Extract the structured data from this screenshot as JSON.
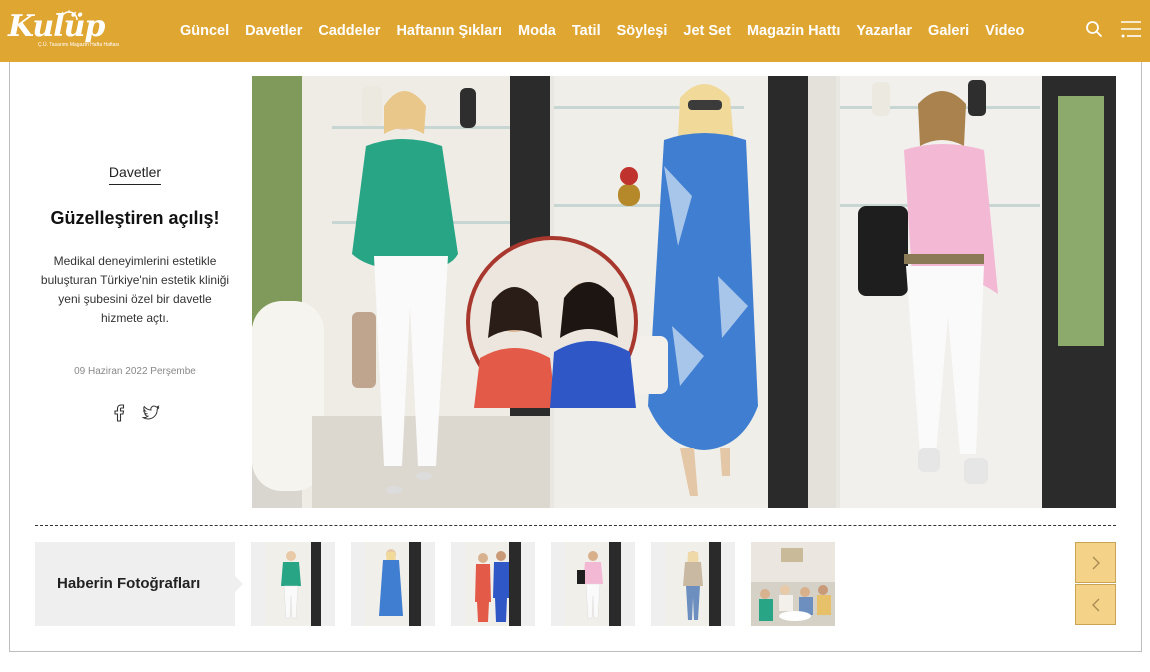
{
  "site": {
    "logo_text": "Kulüp",
    "logo_tagline": "Ç.Ü. Tasarımı Magazin Hafta Haftası"
  },
  "nav": {
    "items": [
      {
        "label": "Güncel"
      },
      {
        "label": "Davetler"
      },
      {
        "label": "Caddeler"
      },
      {
        "label": "Haftanın Şıkları"
      },
      {
        "label": "Moda"
      },
      {
        "label": "Tatil"
      },
      {
        "label": "Söyleşi"
      },
      {
        "label": "Jet Set"
      },
      {
        "label": "Magazin Hattı"
      },
      {
        "label": "Yazarlar"
      },
      {
        "label": "Galeri"
      },
      {
        "label": "Video"
      }
    ],
    "search_icon": "search-icon",
    "menu_icon": "hamburger-menu-icon"
  },
  "article": {
    "category": "Davetler",
    "title": "Güzelleştiren açılış!",
    "summary": "Medikal deneyimlerini estetikle buluşturan Türkiye'nin estetik kliniği yeni şubesini özel bir davetle hizmete açtı.",
    "date": "09 Haziran 2022 Perşembe",
    "share": [
      "facebook-icon",
      "twitter-icon"
    ]
  },
  "gallery": {
    "label": "Haberin Fotoğrafları",
    "thumbnail_count": 6,
    "next_icon": "chevron-right-icon",
    "prev_icon": "chevron-left-icon"
  },
  "colors": {
    "header": "#dfa632",
    "nav_button": "#f4d389",
    "frame_border": "#bdbdbd"
  }
}
